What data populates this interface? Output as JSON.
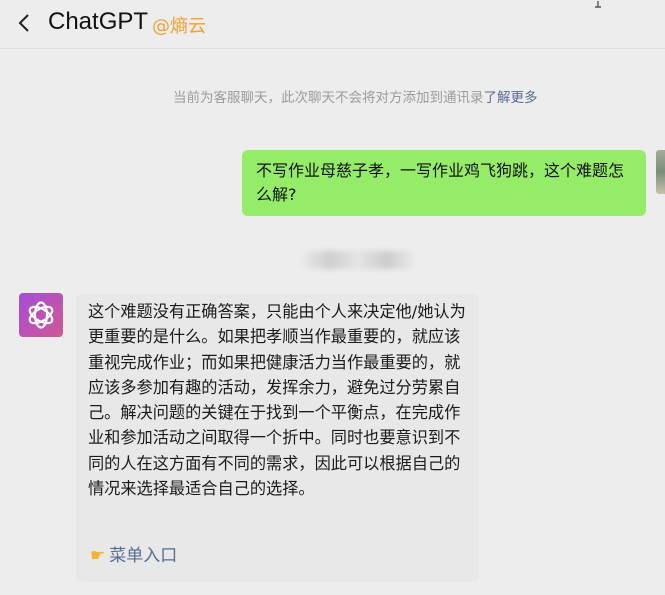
{
  "header": {
    "title": "ChatGPT",
    "subtitle": "@熵云"
  },
  "notice": {
    "text": "当前为客服聊天，此次聊天不会将对方添加到通讯录",
    "link": "了解更多"
  },
  "messages": {
    "user": "不写作业母慈子孝，一写作业鸡飞狗跳，这个难题怎么解?",
    "bot": "这个难题没有正确答案，只能由个人来决定他/她认为更重要的是什么。如果把孝顺当作最重要的，就应该重视完成作业；而如果把健康活力当作最重要的，就应该多参加有趣的活动，发挥余力，避免过分劳累自己。解决问题的关键在于找到一个平衡点，在完成作业和参加活动之间取得一个折中。同时也要意识到不同的人在这方面有不同的需求，因此可以根据自己的情况来选择最适合自己的选择。",
    "menu_icon": "pointing-hand",
    "menu_label": "菜单入口"
  },
  "colors": {
    "user_bubble": "#95ec69",
    "bot_bubble": "#e8e8e8",
    "link": "#576b95",
    "subtitle": "#f0a12b"
  }
}
